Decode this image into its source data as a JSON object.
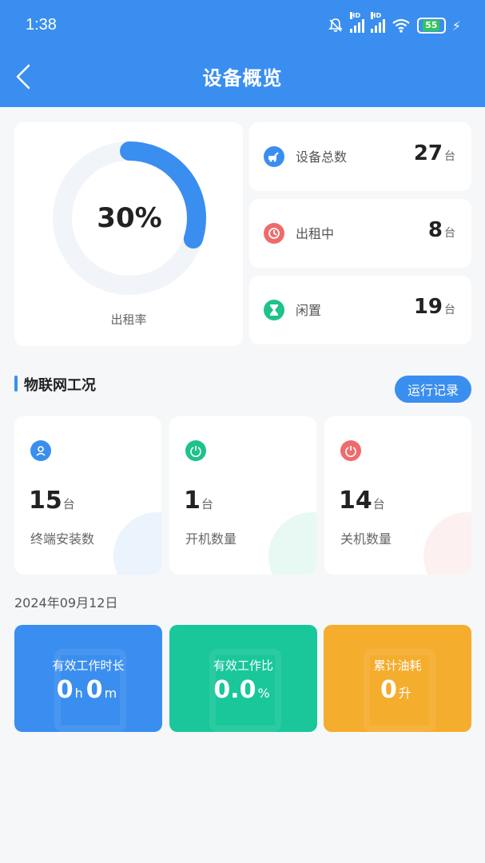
{
  "status_bar": {
    "time": "1:38",
    "battery": "55"
  },
  "header": {
    "title": "设备概览"
  },
  "rental": {
    "rate_value": 0.3,
    "rate_text": "30%",
    "rate_label": "出租率",
    "ring_color": "#3a8ef0",
    "track_color": "#f1f4f9"
  },
  "stats": [
    {
      "label": "设备总数",
      "value": "27",
      "unit": "台",
      "icon": "device-icon",
      "color": "#3a8ef0"
    },
    {
      "label": "出租中",
      "value": "8",
      "unit": "台",
      "icon": "clock-icon",
      "color": "#ef6b6b"
    },
    {
      "label": "闲置",
      "value": "19",
      "unit": "台",
      "icon": "hourglass-icon",
      "color": "#1ec28b"
    }
  ],
  "iot": {
    "title": "物联网工况",
    "log_button": "运行记录",
    "cards": [
      {
        "value": "15",
        "unit": "台",
        "label": "终端安装数",
        "icon": "terminal-icon",
        "color": "#3a8ef0"
      },
      {
        "value": "1",
        "unit": "台",
        "label": "开机数量",
        "icon": "power-on-icon",
        "color": "#1ec28b"
      },
      {
        "value": "14",
        "unit": "台",
        "label": "关机数量",
        "icon": "power-off-icon",
        "color": "#ef6b6b"
      }
    ]
  },
  "daily": {
    "date": "2024年09月12日",
    "metrics": [
      {
        "title": "有效工作时长",
        "v1": "0",
        "u1": "h",
        "v2": "0",
        "u2": "m",
        "color": "#3a8ef0"
      },
      {
        "title": "有效工作比",
        "v1": "0.0",
        "u1": "%",
        "color": "#19c79a"
      },
      {
        "title": "累计油耗",
        "v1": "0",
        "u1": "升",
        "color": "#f5ad2e"
      }
    ]
  }
}
